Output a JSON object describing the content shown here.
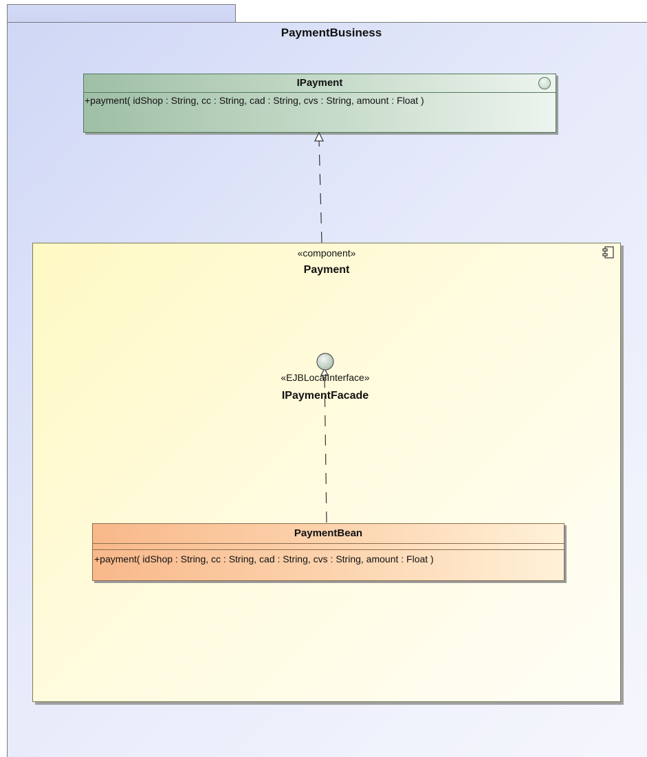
{
  "package": {
    "name": "PaymentBusiness"
  },
  "interface_ipayment": {
    "name": "IPayment",
    "operation": "+payment( idShop : String, cc : String, cad : String, cvs : String, amount : Float )"
  },
  "component": {
    "stereotype": "«component»",
    "name": "Payment"
  },
  "provided_interface": {
    "stereotype": "«EJBLocalInterface»",
    "name": "IPaymentFacade"
  },
  "payment_bean": {
    "name": "PaymentBean",
    "operation": "+payment( idShop : String, cc : String, cad : String, cvs : String, amount : Float )"
  },
  "colors": {
    "package_fill": "#cfd7f6",
    "interface_fill": "#9fbfa6",
    "component_fill": "#fff9c4",
    "bean_fill": "#f8b88a"
  },
  "icons": {
    "interface_marker": "interface-circle-icon",
    "component_marker": "component-icon"
  }
}
